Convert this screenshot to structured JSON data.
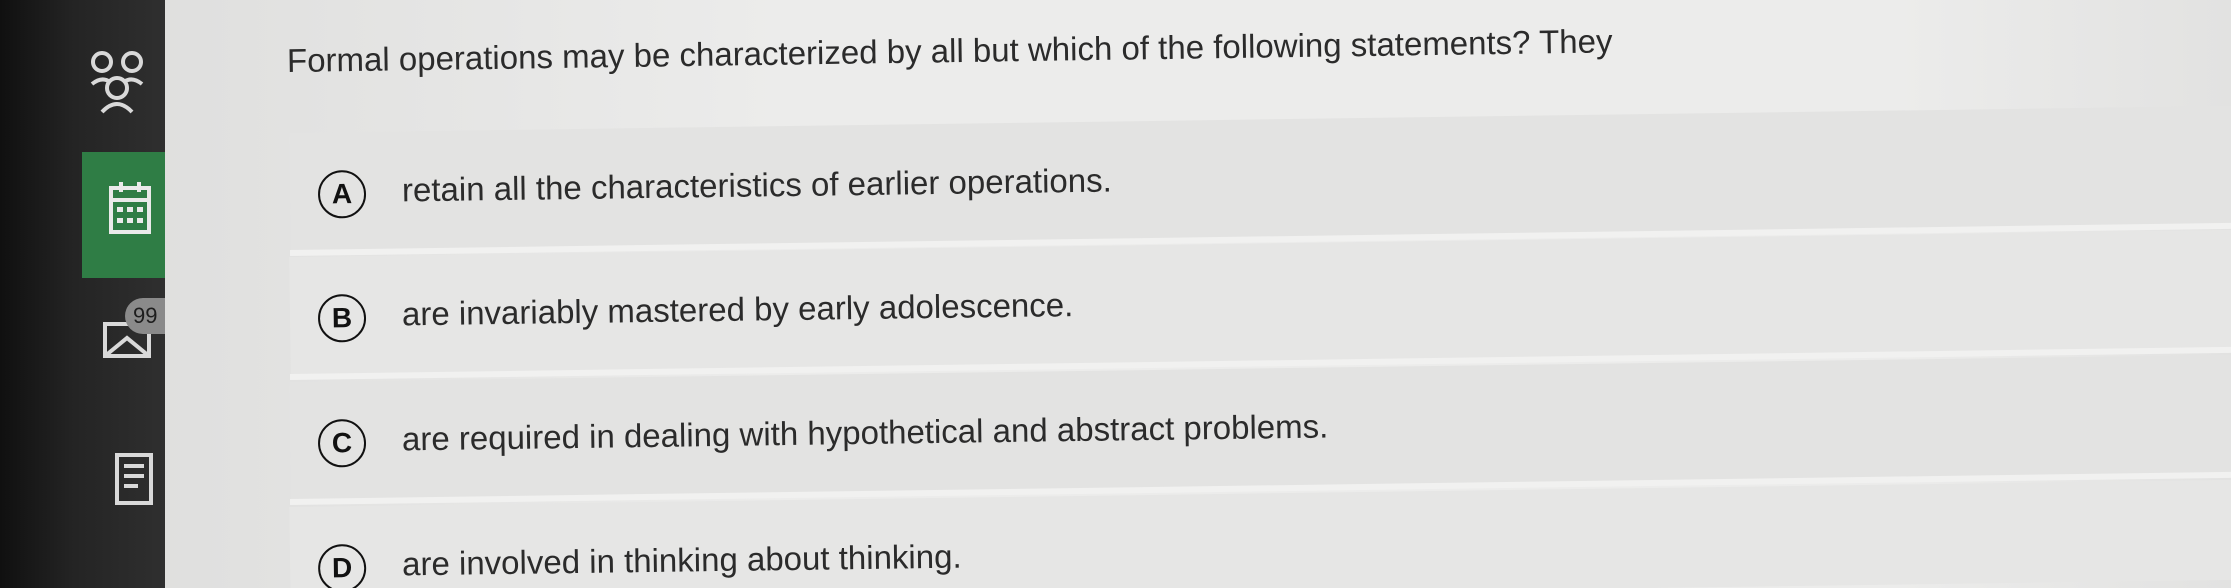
{
  "sidebar": {
    "icons": [
      "people-icon",
      "calendar-icon",
      "mail-icon",
      "notes-icon"
    ],
    "mail_badge": "99",
    "active_color": "#2f7d45"
  },
  "question": {
    "text": "Formal operations may be characterized by all but which of the following statements? They"
  },
  "options": [
    {
      "letter": "A",
      "text": "retain all the characteristics of earlier operations."
    },
    {
      "letter": "B",
      "text": "are invariably mastered by early adolescence."
    },
    {
      "letter": "C",
      "text": "are required in dealing with hypothetical and abstract problems."
    },
    {
      "letter": "D",
      "text": "are involved in thinking about thinking."
    }
  ]
}
